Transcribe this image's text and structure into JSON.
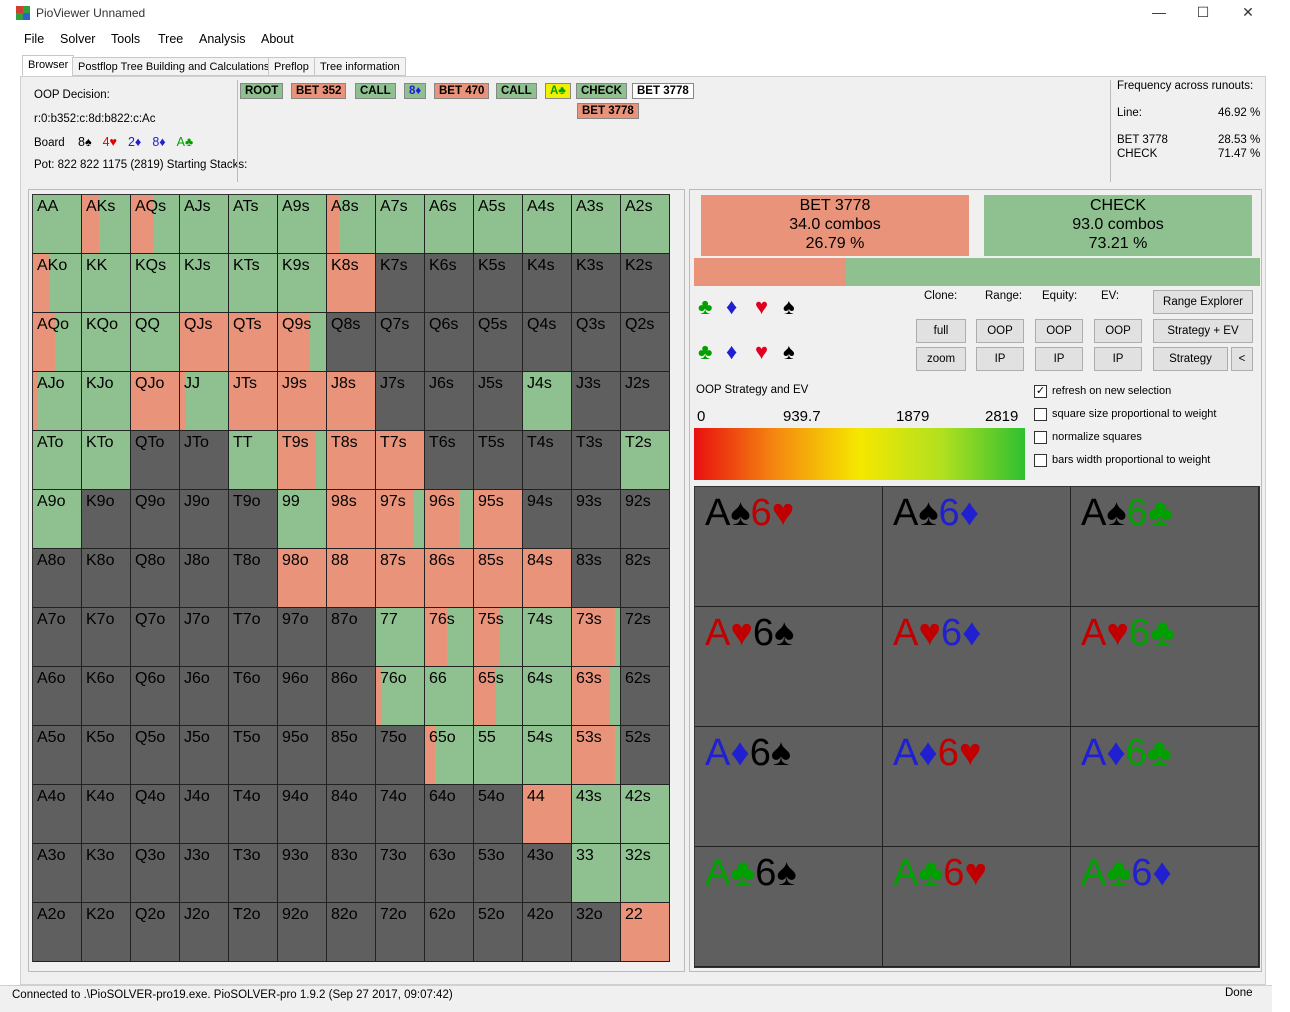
{
  "window": {
    "title": "PioViewer Unnamed",
    "minimize": "—",
    "maximize": "☐",
    "close": "✕"
  },
  "menu": [
    "File",
    "Solver",
    "Tools",
    "Tree",
    "Analysis",
    "About"
  ],
  "tabs": [
    "Browser",
    "Postflop Tree Building and Calculations",
    "Preflop",
    "Tree information"
  ],
  "info": {
    "decision_label": "OOP Decision:",
    "line_code": "r:0:b352:c:8d:b822:c:Ac",
    "board_label": "Board",
    "board": [
      {
        "card": "8♠",
        "color": "#000000"
      },
      {
        "card": "4♥",
        "color": "#e00000"
      },
      {
        "card": "2♦",
        "color": "#2020d0"
      },
      {
        "card": "8♦",
        "color": "#2020d0"
      },
      {
        "card": "A♣",
        "color": "#00a000"
      }
    ],
    "pot": "Pot: 822 822 1175 (2819) Starting Stacks:"
  },
  "nodes": [
    {
      "label": "ROOT",
      "bg": "#8fc08f"
    },
    {
      "label": "BET 352",
      "bg": "#e8937a"
    },
    {
      "label": "CALL",
      "bg": "#8fc08f"
    },
    {
      "label": "8♦",
      "bg": "#8fc08f",
      "fg": "#2020d0"
    },
    {
      "label": "BET 470",
      "bg": "#e8937a"
    },
    {
      "label": "CALL",
      "bg": "#8fc08f"
    },
    {
      "label": "A♣",
      "bg": "#f0f000",
      "fg": "#00a000"
    },
    {
      "label": "CHECK",
      "bg": "#8fc08f"
    },
    {
      "label": "BET 3778",
      "bg": "#ffffff"
    }
  ],
  "next_node": {
    "label": "BET 3778",
    "bg": "#e8937a"
  },
  "frequency": {
    "title": "Frequency across runouts:",
    "line_label": "Line:",
    "line_value": "46.92 %",
    "rows": [
      {
        "label": "BET 3778",
        "value": "28.53 %"
      },
      {
        "label": "CHECK",
        "value": "71.47 %"
      }
    ]
  },
  "actions": [
    {
      "name": "BET 3778",
      "combos": "34.0 combos",
      "pct": "26.79 %",
      "color": "#e8937a"
    },
    {
      "name": "CHECK",
      "combos": "93.0 combos",
      "pct": "73.21 %",
      "color": "#8fc08f"
    }
  ],
  "action_bar_split": 0.2679,
  "colors": {
    "bet": "#e8937a",
    "check": "#8fc08f",
    "empty": "#5f5f5f"
  },
  "suit_filters": [
    "♣",
    "♦",
    "♥",
    "♠"
  ],
  "controls": {
    "clone_label": "Clone:",
    "range_label": "Range:",
    "equity_label": "Equity:",
    "ev_label": "EV:",
    "full": "full",
    "zoom": "zoom",
    "oop": "OOP",
    "ip": "IP",
    "range_explorer": "Range Explorer",
    "strategy_ev": "Strategy + EV",
    "strategy": "Strategy",
    "back": "<"
  },
  "legend": {
    "title": "OOP Strategy and EV",
    "ticks": [
      "0",
      "939.7",
      "1879",
      "2819"
    ]
  },
  "options": [
    {
      "label": "refresh on new selection",
      "checked": true
    },
    {
      "label": "square size proportional to weight",
      "checked": false
    },
    {
      "label": "normalize squares",
      "checked": false
    },
    {
      "label": "bars width proportional to weight",
      "checked": false
    }
  ],
  "combos": [
    [
      {
        "t": "A",
        "c": "#000"
      },
      {
        "t": "♠",
        "c": "#000"
      },
      {
        "t": "6",
        "c": "#c00000"
      },
      {
        "t": "♥",
        "c": "#c00000"
      }
    ],
    [
      {
        "t": "A",
        "c": "#000"
      },
      {
        "t": "♠",
        "c": "#000"
      },
      {
        "t": "6",
        "c": "#2020d0"
      },
      {
        "t": "♦",
        "c": "#2020d0"
      }
    ],
    [
      {
        "t": "A",
        "c": "#000"
      },
      {
        "t": "♠",
        "c": "#000"
      },
      {
        "t": "6",
        "c": "#00a000"
      },
      {
        "t": "♣",
        "c": "#00a000"
      }
    ],
    [
      {
        "t": "A",
        "c": "#c00000"
      },
      {
        "t": "♥",
        "c": "#c00000"
      },
      {
        "t": "6",
        "c": "#000"
      },
      {
        "t": "♠",
        "c": "#000"
      }
    ],
    [
      {
        "t": "A",
        "c": "#c00000"
      },
      {
        "t": "♥",
        "c": "#c00000"
      },
      {
        "t": "6",
        "c": "#2020d0"
      },
      {
        "t": "♦",
        "c": "#2020d0"
      }
    ],
    [
      {
        "t": "A",
        "c": "#c00000"
      },
      {
        "t": "♥",
        "c": "#c00000"
      },
      {
        "t": "6",
        "c": "#00a000"
      },
      {
        "t": "♣",
        "c": "#00a000"
      }
    ],
    [
      {
        "t": "A",
        "c": "#2020d0"
      },
      {
        "t": "♦",
        "c": "#2020d0"
      },
      {
        "t": "6",
        "c": "#000"
      },
      {
        "t": "♠",
        "c": "#000"
      }
    ],
    [
      {
        "t": "A",
        "c": "#2020d0"
      },
      {
        "t": "♦",
        "c": "#2020d0"
      },
      {
        "t": "6",
        "c": "#c00000"
      },
      {
        "t": "♥",
        "c": "#c00000"
      }
    ],
    [
      {
        "t": "A",
        "c": "#2020d0"
      },
      {
        "t": "♦",
        "c": "#2020d0"
      },
      {
        "t": "6",
        "c": "#00a000"
      },
      {
        "t": "♣",
        "c": "#00a000"
      }
    ],
    [
      {
        "t": "A",
        "c": "#00a000"
      },
      {
        "t": "♣",
        "c": "#00a000"
      },
      {
        "t": "6",
        "c": "#000"
      },
      {
        "t": "♠",
        "c": "#000"
      }
    ],
    [
      {
        "t": "A",
        "c": "#00a000"
      },
      {
        "t": "♣",
        "c": "#00a000"
      },
      {
        "t": "6",
        "c": "#c00000"
      },
      {
        "t": "♥",
        "c": "#c00000"
      }
    ],
    [
      {
        "t": "A",
        "c": "#00a000"
      },
      {
        "t": "♣",
        "c": "#00a000"
      },
      {
        "t": "6",
        "c": "#2020d0"
      },
      {
        "t": "♦",
        "c": "#2020d0"
      }
    ]
  ],
  "grid": [
    [
      [
        "AA",
        0
      ],
      [
        "AKs",
        0.35
      ],
      [
        "AQs",
        0.45
      ],
      [
        "AJs",
        0
      ],
      [
        "ATs",
        0
      ],
      [
        "A9s",
        0
      ],
      [
        "A8s",
        0.25
      ],
      [
        "A7s",
        0
      ],
      [
        "A6s",
        0
      ],
      [
        "A5s",
        0
      ],
      [
        "A4s",
        0
      ],
      [
        "A3s",
        0
      ],
      [
        "A2s",
        0
      ]
    ],
    [
      [
        "AKo",
        0.35
      ],
      [
        "KK",
        0
      ],
      [
        "KQs",
        0
      ],
      [
        "KJs",
        0
      ],
      [
        "KTs",
        0
      ],
      [
        "K9s",
        0
      ],
      [
        "K8s",
        1
      ],
      [
        "K7s",
        null
      ],
      [
        "K6s",
        null
      ],
      [
        "K5s",
        null
      ],
      [
        "K4s",
        null
      ],
      [
        "K3s",
        null
      ],
      [
        "K2s",
        null
      ]
    ],
    [
      [
        "AQo",
        0.45
      ],
      [
        "KQo",
        0
      ],
      [
        "QQ",
        0
      ],
      [
        "QJs",
        1
      ],
      [
        "QTs",
        1
      ],
      [
        "Q9s",
        0.65
      ],
      [
        "Q8s",
        null
      ],
      [
        "Q7s",
        null
      ],
      [
        "Q6s",
        null
      ],
      [
        "Q5s",
        null
      ],
      [
        "Q4s",
        null
      ],
      [
        "Q3s",
        null
      ],
      [
        "Q2s",
        null
      ]
    ],
    [
      [
        "AJo",
        0.1
      ],
      [
        "KJo",
        0
      ],
      [
        "QJo",
        1
      ],
      [
        "JJ",
        0.1
      ],
      [
        "JTs",
        1
      ],
      [
        "J9s",
        1
      ],
      [
        "J8s",
        1
      ],
      [
        "J7s",
        null
      ],
      [
        "J6s",
        null
      ],
      [
        "J5s",
        null
      ],
      [
        "J4s",
        0
      ],
      [
        "J3s",
        null
      ],
      [
        "J2s",
        null
      ]
    ],
    [
      [
        "ATo",
        0
      ],
      [
        "KTo",
        0
      ],
      [
        "QTo",
        null
      ],
      [
        "JTo",
        null
      ],
      [
        "TT",
        0
      ],
      [
        "T9s",
        0.8
      ],
      [
        "T8s",
        1
      ],
      [
        "T7s",
        1
      ],
      [
        "T6s",
        null
      ],
      [
        "T5s",
        null
      ],
      [
        "T4s",
        null
      ],
      [
        "T3s",
        null
      ],
      [
        "T2s",
        0
      ]
    ],
    [
      [
        "A9o",
        0
      ],
      [
        "K9o",
        null
      ],
      [
        "Q9o",
        null
      ],
      [
        "J9o",
        null
      ],
      [
        "T9o",
        null
      ],
      [
        "99",
        0
      ],
      [
        "98s",
        1
      ],
      [
        "97s",
        0.8
      ],
      [
        "96s",
        0.7
      ],
      [
        "95s",
        1
      ],
      [
        "94s",
        null
      ],
      [
        "93s",
        null
      ],
      [
        "92s",
        null
      ]
    ],
    [
      [
        "A8o",
        null
      ],
      [
        "K8o",
        null
      ],
      [
        "Q8o",
        null
      ],
      [
        "J8o",
        null
      ],
      [
        "T8o",
        null
      ],
      [
        "98o",
        1
      ],
      [
        "88",
        1
      ],
      [
        "87s",
        1
      ],
      [
        "86s",
        1
      ],
      [
        "85s",
        1
      ],
      [
        "84s",
        1
      ],
      [
        "83s",
        null
      ],
      [
        "82s",
        null
      ]
    ],
    [
      [
        "A7o",
        null
      ],
      [
        "K7o",
        null
      ],
      [
        "Q7o",
        null
      ],
      [
        "J7o",
        null
      ],
      [
        "T7o",
        null
      ],
      [
        "97o",
        null
      ],
      [
        "87o",
        null
      ],
      [
        "77",
        0
      ],
      [
        "76s",
        0.45
      ],
      [
        "75s",
        0.55
      ],
      [
        "74s",
        0
      ],
      [
        "73s",
        0.9
      ],
      [
        "72s",
        null
      ]
    ],
    [
      [
        "A6o",
        null
      ],
      [
        "K6o",
        null
      ],
      [
        "Q6o",
        null
      ],
      [
        "J6o",
        null
      ],
      [
        "T6o",
        null
      ],
      [
        "96o",
        null
      ],
      [
        "86o",
        null
      ],
      [
        "76o",
        0.1
      ],
      [
        "66",
        0
      ],
      [
        "65s",
        0.45
      ],
      [
        "64s",
        0
      ],
      [
        "63s",
        0.8
      ],
      [
        "62s",
        null
      ]
    ],
    [
      [
        "A5o",
        null
      ],
      [
        "K5o",
        null
      ],
      [
        "Q5o",
        null
      ],
      [
        "J5o",
        null
      ],
      [
        "T5o",
        null
      ],
      [
        "95o",
        null
      ],
      [
        "85o",
        null
      ],
      [
        "75o",
        null
      ],
      [
        "65o",
        0.2
      ],
      [
        "55",
        0
      ],
      [
        "54s",
        0
      ],
      [
        "53s",
        0.9
      ],
      [
        "52s",
        null
      ]
    ],
    [
      [
        "A4o",
        null
      ],
      [
        "K4o",
        null
      ],
      [
        "Q4o",
        null
      ],
      [
        "J4o",
        null
      ],
      [
        "T4o",
        null
      ],
      [
        "94o",
        null
      ],
      [
        "84o",
        null
      ],
      [
        "74o",
        null
      ],
      [
        "64o",
        null
      ],
      [
        "54o",
        null
      ],
      [
        "44",
        1
      ],
      [
        "43s",
        0
      ],
      [
        "42s",
        0
      ]
    ],
    [
      [
        "A3o",
        null
      ],
      [
        "K3o",
        null
      ],
      [
        "Q3o",
        null
      ],
      [
        "J3o",
        null
      ],
      [
        "T3o",
        null
      ],
      [
        "93o",
        null
      ],
      [
        "83o",
        null
      ],
      [
        "73o",
        null
      ],
      [
        "63o",
        null
      ],
      [
        "53o",
        null
      ],
      [
        "43o",
        null
      ],
      [
        "33",
        0
      ],
      [
        "32s",
        0
      ]
    ],
    [
      [
        "A2o",
        null
      ],
      [
        "K2o",
        null
      ],
      [
        "Q2o",
        null
      ],
      [
        "J2o",
        null
      ],
      [
        "T2o",
        null
      ],
      [
        "92o",
        null
      ],
      [
        "82o",
        null
      ],
      [
        "72o",
        null
      ],
      [
        "62o",
        null
      ],
      [
        "52o",
        null
      ],
      [
        "42o",
        null
      ],
      [
        "32o",
        null
      ],
      [
        "22",
        1
      ]
    ]
  ],
  "status": {
    "left": "Connected to .\\PioSOLVER-pro19.exe. PioSOLVER-pro 1.9.2 (Sep 27 2017, 09:07:42)",
    "right": "Done"
  }
}
